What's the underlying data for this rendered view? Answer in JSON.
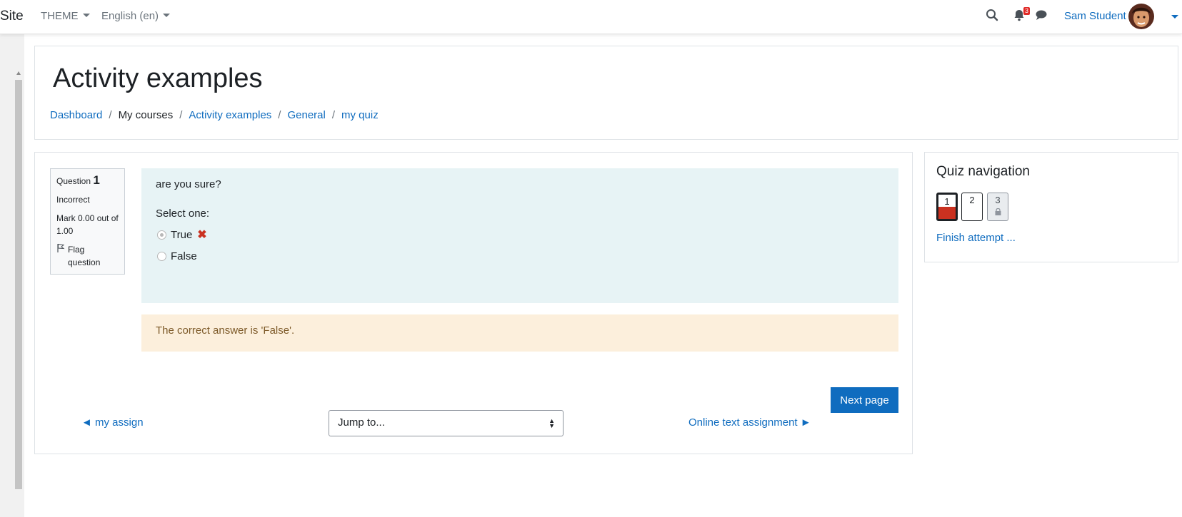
{
  "navbar": {
    "brand": "Site",
    "theme_menu": "THEME",
    "language_menu": "English (en)",
    "notification_count": "3",
    "user_name": "Sam Student"
  },
  "header": {
    "title": "Activity examples",
    "breadcrumb": [
      "Dashboard",
      "My courses",
      "Activity examples",
      "General",
      "my quiz"
    ]
  },
  "question": {
    "label": "Question",
    "number": "1",
    "status": "Incorrect",
    "mark": "Mark 0.00 out of 1.00",
    "flag_label": "Flag question",
    "text": "are you sure?",
    "prompt": "Select one:",
    "options": [
      {
        "label": "True",
        "selected": true,
        "result": "incorrect"
      },
      {
        "label": "False",
        "selected": false
      }
    ],
    "feedback": "The correct answer is 'False'."
  },
  "navigation": {
    "next_page": "Next page",
    "prev_link": "◄ my assign",
    "jump_placeholder": "Jump to...",
    "next_link": "Online text assignment ►"
  },
  "quiz_nav": {
    "title": "Quiz navigation",
    "questions": [
      "1",
      "2",
      "3"
    ],
    "finish": "Finish attempt ..."
  },
  "colors": {
    "link": "#0f6cbf",
    "incorrect": "#ca3120",
    "formulation_bg": "#e7f3f5",
    "feedback_bg": "#fcefdc"
  }
}
